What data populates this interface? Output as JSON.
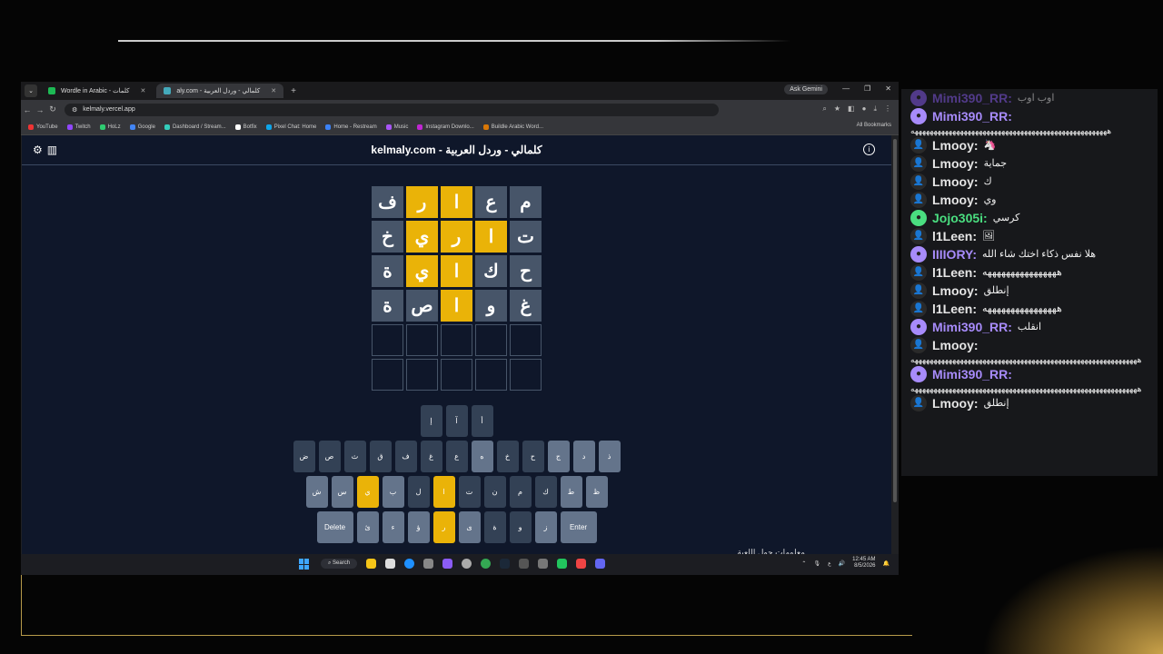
{
  "browser": {
    "tabs": [
      {
        "label": "Wordle in Arabic - كلمات"
      },
      {
        "label": "aly.com - كلمالي - وردل العربية"
      }
    ],
    "ask_gemini": "Ask Gemini",
    "url": "kelmaly.vercel.app",
    "bookmarks": [
      "YouTube",
      "Twitch",
      "HoLz",
      "Google",
      "Dashboard / Stream...",
      "Botfix",
      "Pixel Chat: Home",
      "Home - Restream",
      "Music",
      "Instagram Downlo...",
      "Buildle Arabic Word..."
    ],
    "all_bookmarks": "All Bookmarks"
  },
  "site": {
    "title": "kelmaly.com - كلمالي - وردل العربية",
    "grid": [
      [
        {
          "l": "ف",
          "s": "absent"
        },
        {
          "l": "ر",
          "s": "present"
        },
        {
          "l": "ا",
          "s": "present"
        },
        {
          "l": "ع",
          "s": "absent"
        },
        {
          "l": "م",
          "s": "absent"
        }
      ],
      [
        {
          "l": "خ",
          "s": "absent"
        },
        {
          "l": "ي",
          "s": "present"
        },
        {
          "l": "ر",
          "s": "present"
        },
        {
          "l": "ا",
          "s": "present"
        },
        {
          "l": "ت",
          "s": "absent"
        }
      ],
      [
        {
          "l": "ة",
          "s": "absent"
        },
        {
          "l": "ي",
          "s": "present"
        },
        {
          "l": "ا",
          "s": "present"
        },
        {
          "l": "ك",
          "s": "absent"
        },
        {
          "l": "ح",
          "s": "absent"
        }
      ],
      [
        {
          "l": "ة",
          "s": "absent"
        },
        {
          "l": "ص",
          "s": "absent"
        },
        {
          "l": "ا",
          "s": "present"
        },
        {
          "l": "و",
          "s": "absent"
        },
        {
          "l": "غ",
          "s": "absent"
        }
      ],
      [
        {
          "l": "",
          "s": "empty"
        },
        {
          "l": "",
          "s": "empty"
        },
        {
          "l": "",
          "s": "empty"
        },
        {
          "l": "",
          "s": "empty"
        },
        {
          "l": "",
          "s": "empty"
        }
      ],
      [
        {
          "l": "",
          "s": "empty"
        },
        {
          "l": "",
          "s": "empty"
        },
        {
          "l": "",
          "s": "empty"
        },
        {
          "l": "",
          "s": "empty"
        },
        {
          "l": "",
          "s": "empty"
        }
      ]
    ],
    "keyboard": [
      [
        {
          "l": "إ",
          "s": "absent"
        },
        {
          "l": "آ",
          "s": "absent"
        },
        {
          "l": "أ",
          "s": "absent"
        }
      ],
      [
        {
          "l": "ض",
          "s": "absent"
        },
        {
          "l": "ص",
          "s": "absent"
        },
        {
          "l": "ث",
          "s": "absent"
        },
        {
          "l": "ق",
          "s": "absent"
        },
        {
          "l": "ف",
          "s": "absent"
        },
        {
          "l": "غ",
          "s": "absent"
        },
        {
          "l": "ع",
          "s": "absent"
        },
        {
          "l": "ه",
          "s": "unused"
        },
        {
          "l": "خ",
          "s": "absent"
        },
        {
          "l": "ح",
          "s": "absent"
        },
        {
          "l": "ج",
          "s": "unused"
        },
        {
          "l": "د",
          "s": "unused"
        },
        {
          "l": "ذ",
          "s": "unused"
        }
      ],
      [
        {
          "l": "ش",
          "s": "unused"
        },
        {
          "l": "س",
          "s": "unused"
        },
        {
          "l": "ي",
          "s": "present"
        },
        {
          "l": "ب",
          "s": "unused"
        },
        {
          "l": "ل",
          "s": "absent"
        },
        {
          "l": "ا",
          "s": "present"
        },
        {
          "l": "ت",
          "s": "absent"
        },
        {
          "l": "ن",
          "s": "absent"
        },
        {
          "l": "م",
          "s": "absent"
        },
        {
          "l": "ك",
          "s": "absent"
        },
        {
          "l": "ط",
          "s": "unused"
        },
        {
          "l": "ظ",
          "s": "unused"
        }
      ],
      [
        {
          "l": "Delete",
          "s": "unused",
          "wide": true
        },
        {
          "l": "ئ",
          "s": "unused"
        },
        {
          "l": "ء",
          "s": "unused"
        },
        {
          "l": "ؤ",
          "s": "unused"
        },
        {
          "l": "ر",
          "s": "present"
        },
        {
          "l": "ى",
          "s": "unused"
        },
        {
          "l": "ة",
          "s": "absent"
        },
        {
          "l": "و",
          "s": "absent"
        },
        {
          "l": "ز",
          "s": "unused"
        },
        {
          "l": "Enter",
          "s": "unused",
          "wide": true
        }
      ]
    ],
    "overflow_text": "معلومات حول اللعبة"
  },
  "taskbar": {
    "search": "Search",
    "time": "12:45 AM",
    "date": "8/5/2026",
    "tray_lang": "ع"
  },
  "chat": [
    {
      "user": "Mimi390_RR",
      "color": "#8b5cf6",
      "text": "اوب اوب",
      "faded": true,
      "avatar": "img"
    },
    {
      "user": "Mimi390_RR",
      "color": "#a78bfa",
      "text": "",
      "avatar": "img"
    },
    {
      "wrap": "ههههههههههههههههههههههههههههههههههههههههههههههههههههه"
    },
    {
      "user": "Lmooy",
      "color": "#e5e5e5",
      "text": "🦄",
      "avatar": "person"
    },
    {
      "user": "Lmooy",
      "color": "#e5e5e5",
      "text": "جماية",
      "avatar": "person"
    },
    {
      "user": "Lmooy",
      "color": "#e5e5e5",
      "text": "ك",
      "avatar": "person"
    },
    {
      "user": "Lmooy",
      "color": "#e5e5e5",
      "text": "وي",
      "avatar": "person"
    },
    {
      "user": "Jojo305i",
      "color": "#4ade80",
      "text": "كرسي",
      "avatar": "img"
    },
    {
      "user": "l1Leen",
      "color": "#e5e5e5",
      "text": "🖼",
      "avatar": "person"
    },
    {
      "user": "IIIIORY",
      "color": "#a78bfa",
      "text": "هلا نفس ذكاء اختك شاء الله",
      "avatar": "img"
    },
    {
      "user": "l1Leen",
      "color": "#e5e5e5",
      "text": "ههههههههههههههههه",
      "avatar": "person"
    },
    {
      "user": "Lmooy",
      "color": "#e5e5e5",
      "text": "إنطلق",
      "avatar": "person"
    },
    {
      "user": "l1Leen",
      "color": "#e5e5e5",
      "text": "ههههههههههههههههه",
      "avatar": "person"
    },
    {
      "user": "Mimi390_RR",
      "color": "#a78bfa",
      "text": "انقلب",
      "avatar": "img"
    },
    {
      "user": "Lmooy",
      "color": "#e5e5e5",
      "text": "",
      "avatar": "person"
    },
    {
      "wrap": "ههههههههههههههههههههههههههههههههههههههههههههههههههههههههههههه"
    },
    {
      "user": "Mimi390_RR",
      "color": "#a78bfa",
      "text": "",
      "avatar": "img"
    },
    {
      "wrap": "ههههههههههههههههههههههههههههههههههههههههههههههههههههههههههههه"
    },
    {
      "user": "Lmooy",
      "color": "#e5e5e5",
      "text": "إنطلق",
      "avatar": "person"
    }
  ]
}
